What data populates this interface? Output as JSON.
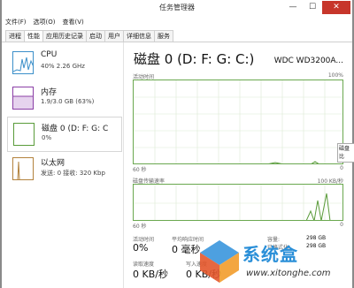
{
  "window": {
    "title": "任务管理器",
    "minimize": "—",
    "maximize": "☐",
    "close": "✕"
  },
  "menu": [
    "文件(F)",
    "选项(O)",
    "查看(V)"
  ],
  "tabs": [
    "进程",
    "性能",
    "应用历史记录",
    "启动",
    "用户",
    "详细信息",
    "服务"
  ],
  "active_tab": "性能",
  "resources": [
    {
      "name": "CPU",
      "detail": "40% 2.26 GHz",
      "color": "#3b8fc9"
    },
    {
      "name": "内存",
      "detail": "1.9/3.0 GB (63%)",
      "color": "#8b3fa6"
    },
    {
      "name": "磁盘 0 (D: F: G: C",
      "detail": "0%",
      "color": "#5a9b3a"
    },
    {
      "name": "以太网",
      "detail": "发送: 0 接收: 320 Kbp",
      "color": "#b3823d"
    }
  ],
  "disk": {
    "title": "磁盘 0 (D: F: G: C:)",
    "model": "WDC WD3200A...",
    "activity_label": "活动时间",
    "activity_max": "100%",
    "time_left": "60 秒",
    "time_right": "0",
    "transfer_label": "磁盘传输速率",
    "transfer_max": "100 KB/秒",
    "transfer_time_left": "60 秒",
    "transfer_time_right": "0",
    "activity_time_label": "活动时间",
    "activity_time_value": "0%",
    "avg_response_label": "平均响应时间",
    "avg_response_value": "0 毫秒",
    "read_speed_label": "读取速度",
    "read_speed_value": "0 KB/秒",
    "write_speed_label": "写入速度",
    "write_speed_value": "0 KB/秒",
    "capacity_label": "容量:",
    "capacity_value": "298 GB",
    "formatted_label": "已格式化:",
    "formatted_value": "298 GB",
    "tooltip": "磁盘\n比"
  },
  "watermark": {
    "text": "系统盒",
    "url": "www.xitonghe.com"
  }
}
